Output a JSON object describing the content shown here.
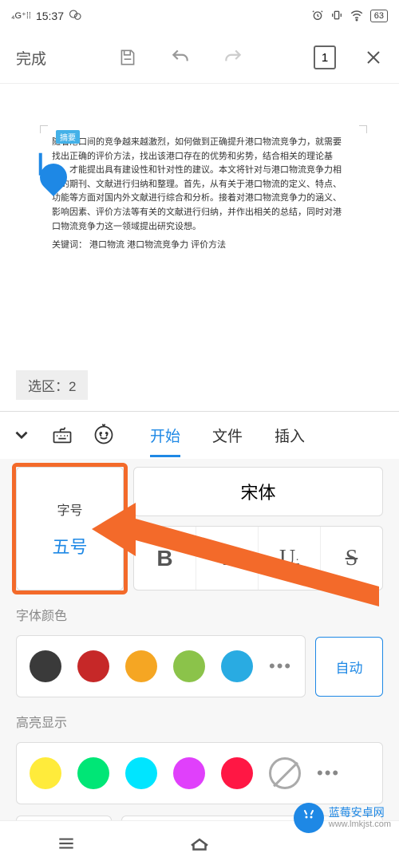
{
  "status": {
    "signal_label": "4G+",
    "time": "15:37",
    "battery": "63"
  },
  "toolbar": {
    "done": "完成",
    "page": "1"
  },
  "doc": {
    "badge": "摘要",
    "body": "随着港口间的竞争越来越激烈，如何做到正确提升港口物流竞争力，就需要找出正确的评价方法，找出该港口存在的优势和劣势，结合相关的理论基础，才能提出具有建设性和针对性的建议。本文将针对与港口物流竞争力相关的期刊、文献进行归纳和整理。首先，从有关于港口物流的定义、特点、功能等方面对国内外文献进行综合和分析。接着对港口物流竞争力的涵义、影响因素、评价方法等有关的文献进行归纳，并作出相关的总结，同时对港口物流竞争力这一领域提出研究设想。",
    "keywords": "关键词：  港口物流  港口物流竞争力    评价方法"
  },
  "selection": {
    "label": "选区：",
    "value": "2"
  },
  "tabs": {
    "start": "开始",
    "file": "文件",
    "insert": "插入"
  },
  "font": {
    "size_label": "字号",
    "size_value": "五号",
    "name": "宋体"
  },
  "sections": {
    "font_color": "字体颜色",
    "highlight": "高亮显示"
  },
  "auto": "自动",
  "colors_font": [
    "#3a3a3a",
    "#c62828",
    "#f5a623",
    "#8bc34a",
    "#29abe2"
  ],
  "colors_highlight": [
    "#ffeb3b",
    "#00e676",
    "#00e5ff",
    "#e040fb",
    "#ff1744"
  ],
  "watermark": {
    "name": "蓝莓安卓网",
    "url": "www.lmkjst.com"
  }
}
